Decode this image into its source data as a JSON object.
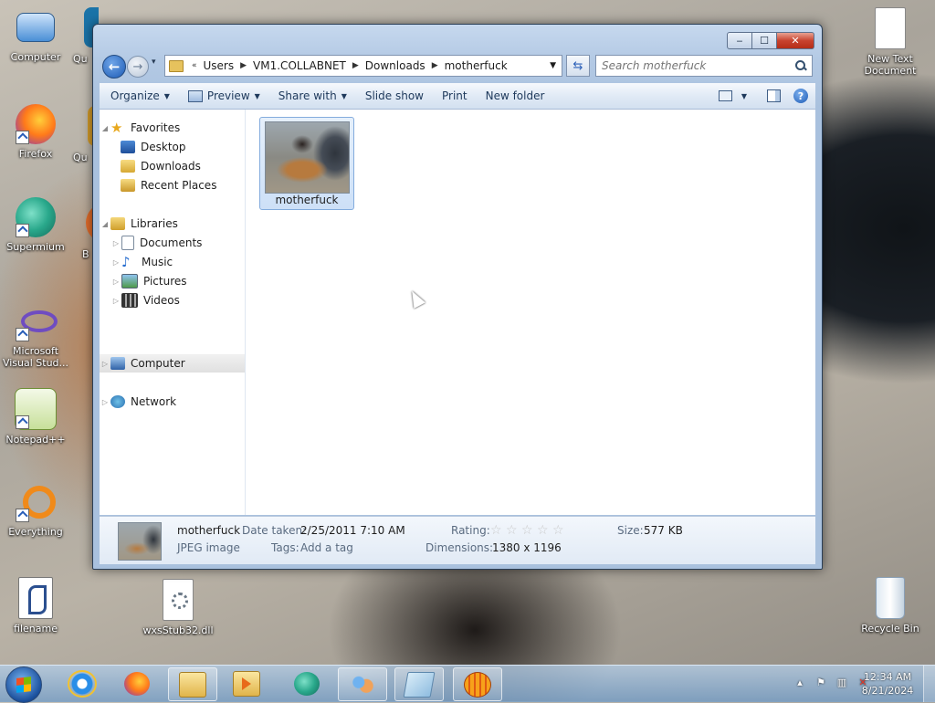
{
  "desktop": {
    "icons_left": [
      {
        "label": "Computer",
        "name": "computer-icon",
        "color": "#4a8fd6"
      },
      {
        "label": "Firefox",
        "name": "firefox-icon",
        "color": "#ff7a1a"
      },
      {
        "label": "Supermium",
        "name": "supermium-icon",
        "color": "#29a88b"
      },
      {
        "label": "Microsoft Visual Stud...",
        "name": "visual-studio-icon",
        "color": "#6f4cc1"
      },
      {
        "label": "Notepad++",
        "name": "notepadpp-icon",
        "color": "#8fc34a"
      },
      {
        "label": "Everything",
        "name": "everything-icon",
        "color": "#f08a1a"
      },
      {
        "label": "filename",
        "name": "script-file-icon",
        "color": "#ffffff"
      }
    ],
    "icons_second_column": [
      {
        "label": "Qu",
        "name": "quick-app-icon",
        "color": "#1a73a8"
      },
      {
        "label": "Qu",
        "name": "quick-app-icon-2",
        "color": "#d39b2a"
      },
      {
        "label": "B",
        "name": "partial-app-icon",
        "color": "#e06b2a"
      }
    ],
    "wxsstub": {
      "label": "wxsStub32.dll",
      "name": "dll-file-icon"
    },
    "new_text_doc": {
      "label": "New Text Document",
      "name": "text-document-icon"
    },
    "recycle_bin": {
      "label": "Recycle Bin",
      "name": "recycle-bin-icon"
    }
  },
  "window": {
    "controls": {
      "minimize": "‒",
      "maximize": "☐",
      "close": "✕"
    },
    "nav": {
      "back": "←",
      "forward": "→",
      "history": "▾",
      "refresh": "⇆"
    },
    "breadcrumb": {
      "overflow": "«",
      "parts": [
        "Users",
        "VM1.COLLABNET",
        "Downloads",
        "motherfuck"
      ]
    },
    "search": {
      "placeholder": "Search motherfuck"
    },
    "toolbar": {
      "organize": "Organize",
      "preview": "Preview",
      "share_with": "Share with",
      "slide_show": "Slide show",
      "print": "Print",
      "new_folder": "New folder",
      "help": "?"
    },
    "nav_pane": {
      "favorites": "Favorites",
      "desktop": "Desktop",
      "downloads": "Downloads",
      "recent_places": "Recent Places",
      "libraries": "Libraries",
      "documents": "Documents",
      "music": "Music",
      "pictures": "Pictures",
      "videos": "Videos",
      "computer": "Computer",
      "network": "Network"
    },
    "file": {
      "name": "motherfuck"
    },
    "details": {
      "name": "motherfuck",
      "type": "JPEG image",
      "date_taken_label": "Date taken:",
      "date_taken": "2/25/2011 7:10 AM",
      "tags_label": "Tags:",
      "tags": "Add a tag",
      "rating_label": "Rating:",
      "rating": 0,
      "rating_max": 5,
      "dimensions_label": "Dimensions:",
      "dimensions": "1380 x 1196",
      "size_label": "Size:",
      "size": "577 KB"
    }
  },
  "taskbar": {
    "clock_time": "12:34 AM",
    "clock_date": "8/21/2024",
    "tray_arrow": "▴",
    "tray_flag": "⚑",
    "tray_network": "▥",
    "tray_volume": "✕"
  },
  "colors": {
    "accent": "#1d5bb5",
    "selection_border": "#84acdd",
    "window_frame": "#b3c9e4"
  }
}
